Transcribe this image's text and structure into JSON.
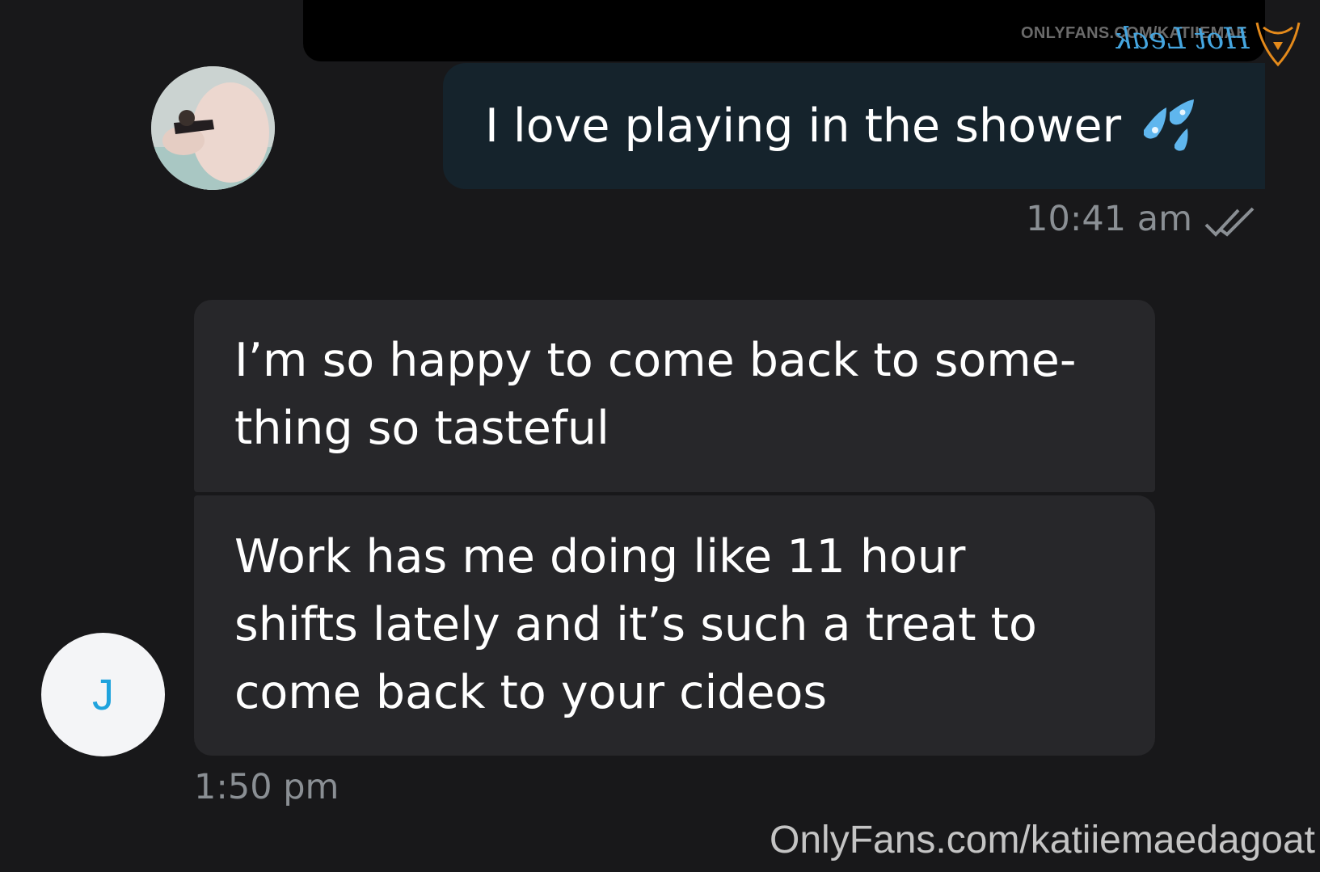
{
  "watermark_top": "ONLYFANS.COM/KATIIEMAE",
  "overlay_logo": "Hot Leak",
  "messages": [
    {
      "direction": "outgoing",
      "text": "I love playing in the shower",
      "emoji": "sweat-droplets-icon",
      "time": "10:41 am",
      "status": "read"
    },
    {
      "direction": "incoming",
      "sender_initial": "J",
      "lines": [
        "I’m so happy to come back to some-",
        "thing so tasteful"
      ]
    },
    {
      "direction": "incoming",
      "lines": [
        "Work has me doing like 11 hour",
        "shifts lately and it’s such a treat to",
        "come back to your cideos"
      ],
      "time": "1:50 pm"
    }
  ],
  "watermark_bottom": "OnlyFans.com/katiiemaedagoat",
  "colors": {
    "background": "#18181a",
    "outgoing_bubble": "#15232c",
    "incoming_bubble": "#27272a",
    "timestamp": "#8a8f94",
    "initial_accent": "#1fa3dd",
    "logo_blue": "#45a6e0"
  }
}
